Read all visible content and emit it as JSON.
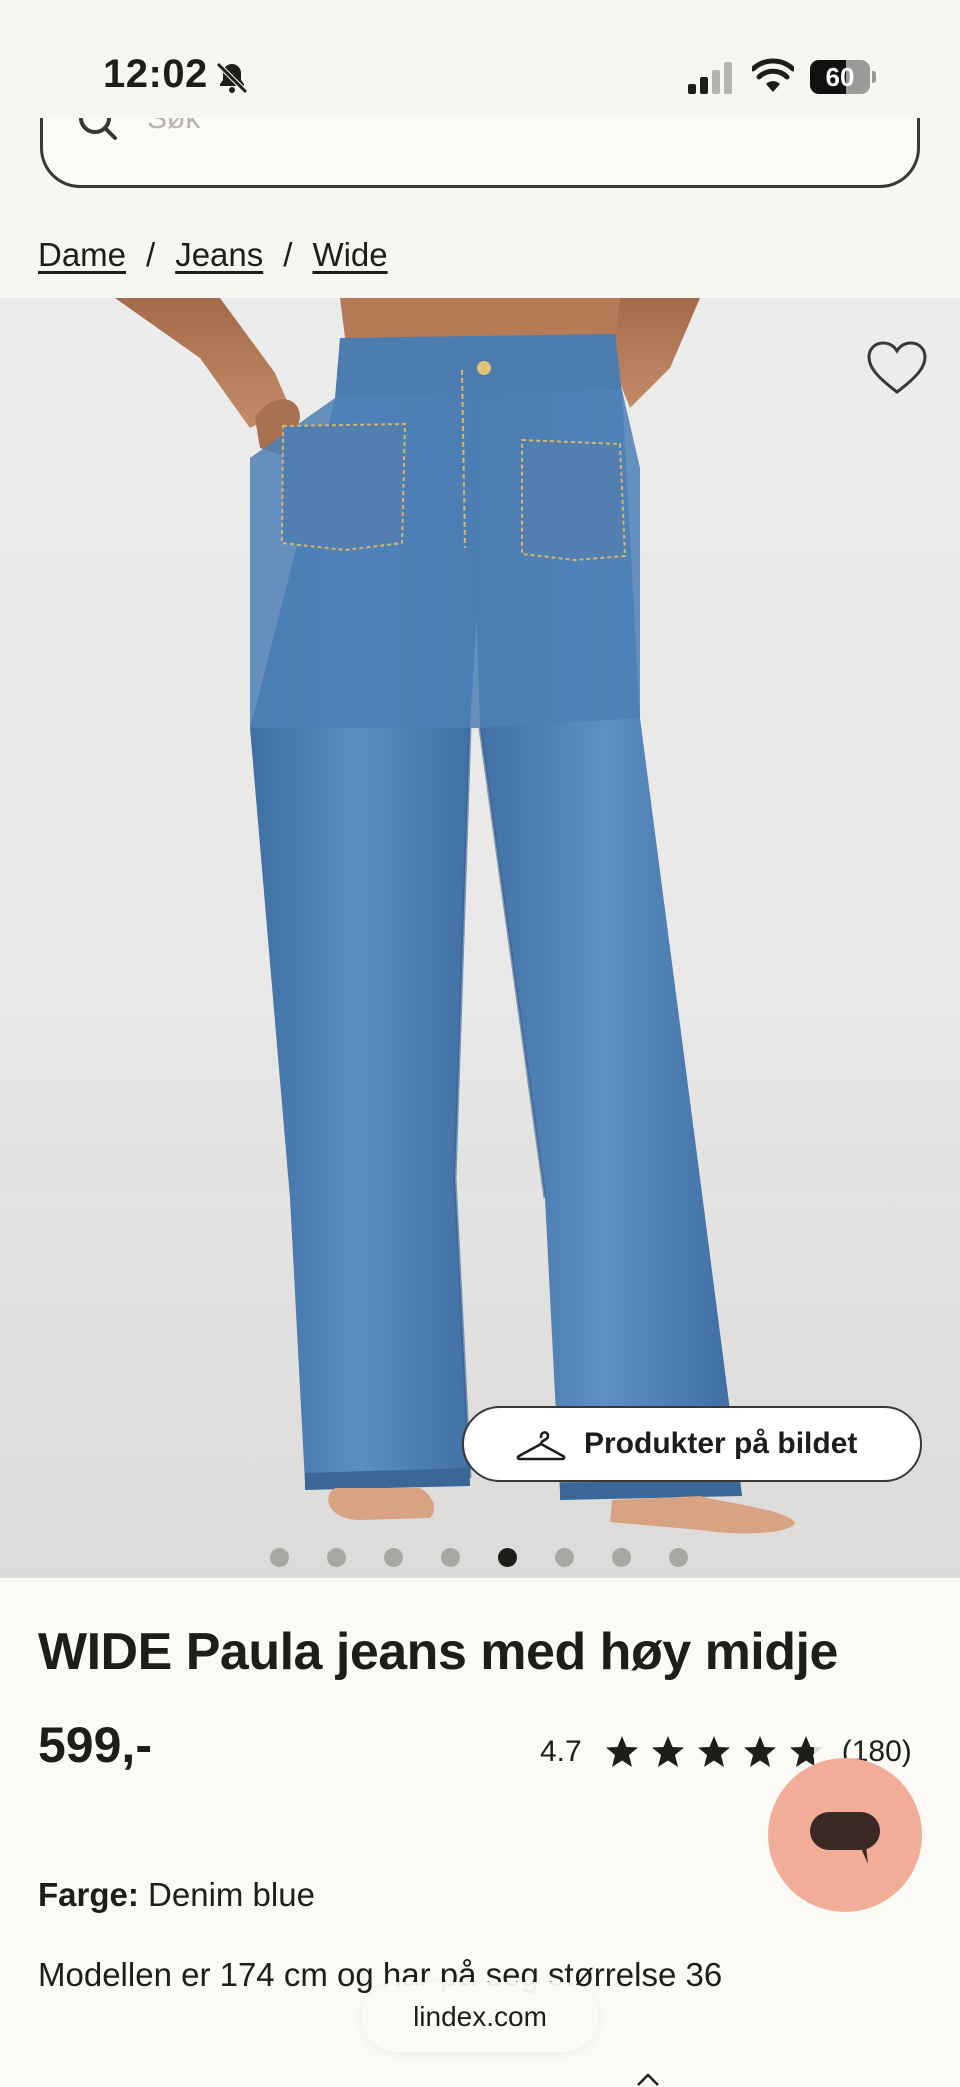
{
  "status_bar": {
    "time": "12:02",
    "battery": "60",
    "icons": [
      "bell-muted-icon",
      "cellular-signal-icon",
      "wifi-icon",
      "battery-icon"
    ]
  },
  "search": {
    "placeholder": "Søk",
    "icon": "search-icon"
  },
  "breadcrumb": {
    "items": [
      "Dame",
      "Jeans",
      "Wide"
    ],
    "separator": "/"
  },
  "gallery": {
    "image_subject": "model wearing blue wide-leg jeans",
    "favorite_icon": "heart-outline-icon",
    "products_in_image_label": "Produkter på bildet",
    "products_icon": "hanger-icon",
    "dot_count": 8,
    "active_dot": 5
  },
  "product": {
    "title": "WIDE Paula jeans med høy midje",
    "price": "599,-",
    "rating": "4.7",
    "rating_count": "(180)",
    "stars": 4.7,
    "color_label": "Farge:",
    "color_value": "Denim blue",
    "model_info": "Modellen er 174 cm og har på seg størrelse 36"
  },
  "chat": {
    "icon": "chat-icon",
    "color": "#f2ad98"
  },
  "browser": {
    "url": "lindex.com"
  },
  "colors": {
    "background": "#fbfaf7",
    "text": "#1f1d1a",
    "denim": "#4f7fb2",
    "chat_accent": "#f2ad98"
  }
}
